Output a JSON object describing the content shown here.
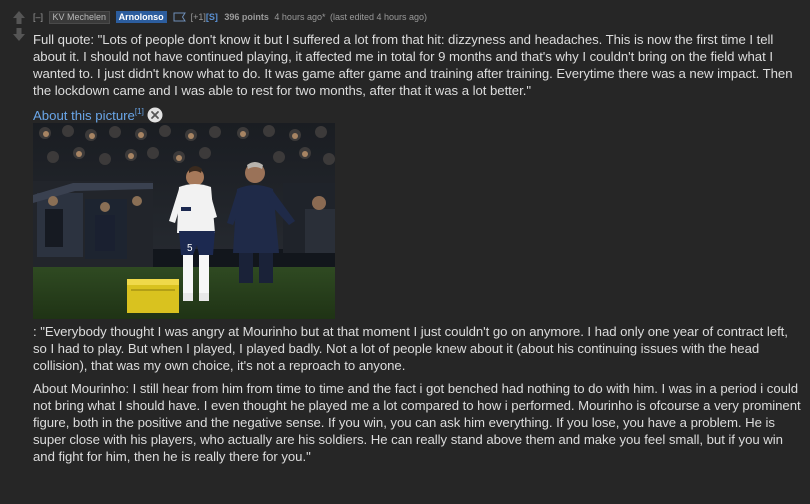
{
  "comment": {
    "collapse_label": "[–]",
    "flair": "KV Mechelen",
    "author": "Arnolonso",
    "gilded_prefix": "[+1]",
    "gilded_level": "[S]",
    "score": "396 points",
    "time": "4 hours ago*",
    "edited": "(last edited 4 hours ago)",
    "paragraph_1": "Full quote: \"Lots of people don't know it but I suffered a lot from that hit: dizzyness and headaches. This is now the first time I tell about it. I should not have continued playing, it affected me in total for 9 months and that's why I couldn't bring on the field what I wanted to. I just didn't know what to do. It was game after game and training after training. Everytime there was a new impact. Then the lockdown came and I was able to rest for two months, after that it was a lot better.\"",
    "picture_link": "About this picture",
    "picture_sup": "[1]",
    "paragraph_2": ": \"Everybody thought I was angry at Mourinho but at that moment I just couldn't go on anymore. I had only one year of contract left, so I had to play. But when I played, I played badly. Not a lot of people knew about it (about his continuing issues with the head collision), that was my own choice, it's not a reproach to anyone.",
    "paragraph_3": "About Mourinho: I still hear from him from time to time and the fact i got benched had nothing to do with him. I was in a period i could not bring what I should have. I even thought he played me a lot compared to how i performed. Mourinho is ofcourse a very prominent figure, both in the positive and the negative sense. If you win, you can ask him everything. If you lose, you have a problem. He is super close with his players, who actually are his soldiers. He can really stand above them and make you feel small, but if you win and fight for him, then he is really there for you.\""
  },
  "colors": {
    "background": "#262626",
    "text": "#dcdcdc",
    "link": "#6aa6e8",
    "author_badge": "#2c5d9e",
    "meta": "#9a9a9a"
  },
  "icons": {
    "upvote": "up-arrow-icon",
    "downvote": "down-arrow-icon",
    "flag": "flag-icon",
    "close": "close-icon"
  }
}
